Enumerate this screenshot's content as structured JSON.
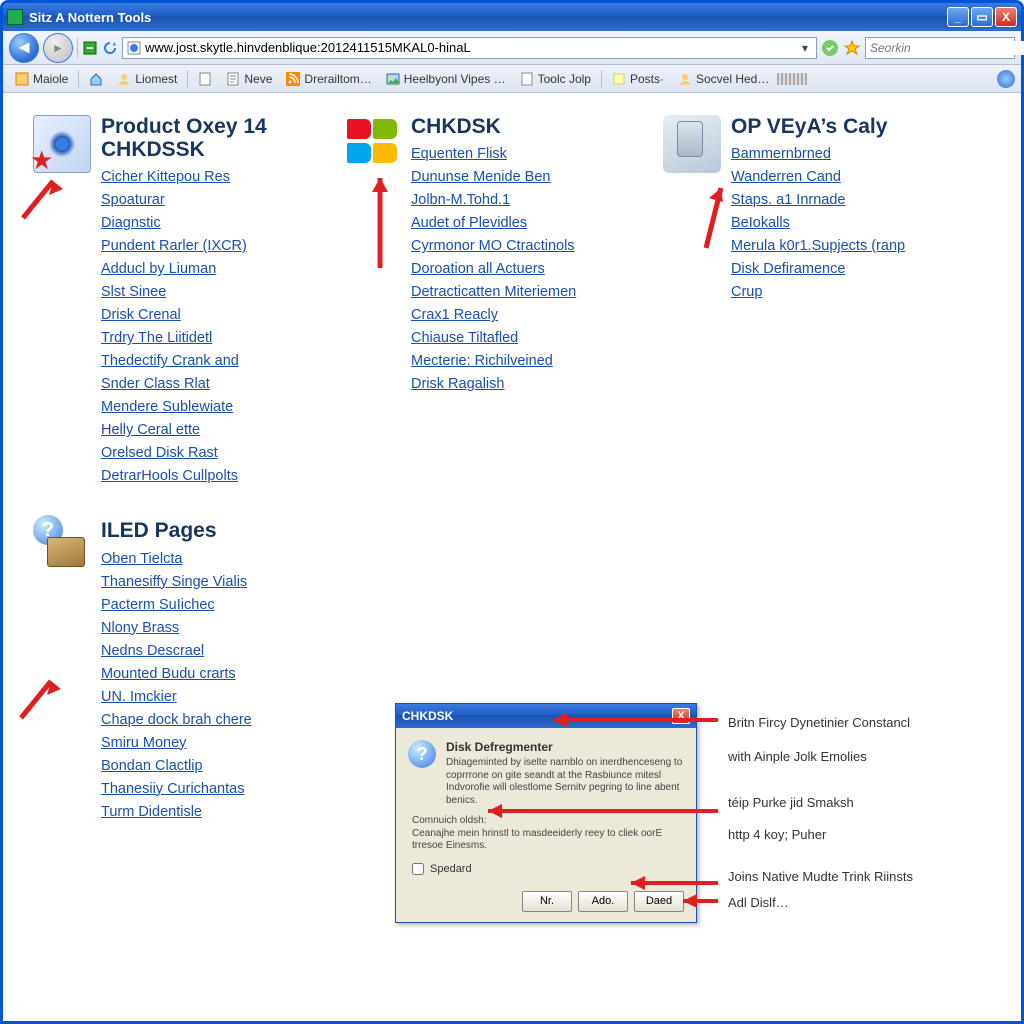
{
  "window": {
    "title": "Sitz A Nottern Tools"
  },
  "nav": {
    "url": "www.jost.skytle.hinvdenblique:2012411515MKAL0-hinaL",
    "search_placeholder": "Seorkin"
  },
  "links_bar": {
    "items": [
      {
        "label": "Maiole"
      },
      {
        "label": "Liomest"
      },
      {
        "label": "Neve"
      },
      {
        "label": "Drerailtom…"
      },
      {
        "label": "Heelbyonl Vipes …"
      },
      {
        "label": "Toolc Jolp"
      },
      {
        "label": "Posts·"
      },
      {
        "label": "Socvel Hed…"
      }
    ]
  },
  "sections": {
    "product": {
      "title": "Product Oxey 14 CHKDSSK",
      "links": [
        "Cicher Kittepou Res",
        "Spoaturar",
        "Diagnstic",
        "Pundent Rarler (IXCR)",
        "Adducl by Liuman",
        "Slst Sinee",
        "Drisk Crenal",
        "Trdry The Liitidetl",
        "Thedectify Crank and",
        "Snder Class Rlat",
        "Mendere Sublewiate",
        "Helly Ceral ette",
        "Orelsed Disk Rast",
        "DetrarHools Cullpolts"
      ]
    },
    "chkdsk": {
      "title": "CHKDSK",
      "links": [
        "Equenten Flisk",
        "Dununse Menide Ben",
        "Jolbn-M.Tohd.1",
        "Audet of Plevidles",
        "Cyrmonor MO Ctractinols",
        "Doroation all Actuers",
        "Detracticatten Miteriemen",
        "Crax1 Reacly",
        "Chiause Tiltafled",
        "Mecterie: Richilveined",
        "Drisk Ragalish"
      ]
    },
    "opvey": {
      "title": "OP VEyA’s Caly",
      "links": [
        "Bammernbrned",
        "Wanderren Cand",
        "Staps. a1 Inrnade",
        "BeIokalls",
        "Merula k0r1.Supjects (ranp",
        "Disk Defiramence",
        "Crup"
      ]
    },
    "iled": {
      "title": "ILED Pages",
      "links": [
        "Oben Tielcta",
        "Thanesiffy Singe Vialis",
        "Pacterm SuIichec",
        "Nlony Brass",
        "Nedns Descrael",
        "Mounted Budu crarts",
        "UN. Imckier",
        "Chape dock brah chere",
        "Smiru Money",
        "Bondan Clactlip",
        "Thanesiiy Curichantas",
        "Turm Didentisle"
      ]
    }
  },
  "dialog": {
    "title": "CHKDSK",
    "heading": "Disk Defregmenter",
    "body1": "Dhiageminted by iselte narnblo on inerdhenceseng to coprrrone on gite seandt at the Rasbiunce mitesl Indvorofie will olestlome Sernitv pegring to line abent benics.",
    "body2_label": "Comnuich oldsh:",
    "body2": "Ceanajhe mein hrinstl to masdeeiderly reey to cliek oorE trresoe Einesms.",
    "checkbox": "Spedard",
    "btn_no": "Nr.",
    "btn_ado": "Ado.",
    "btn_daed": "Daed"
  },
  "annotations": {
    "a1": "Britn Fircy Dynetinier Constancl",
    "a2": "with Ainple Jolk Emolies",
    "a3": "téip Purke jid Smaksh",
    "a4": "http 4 koy; Puher",
    "a5": "Joins Native Mudte Trink Riinsts",
    "a6": "Adl Dislf…"
  }
}
